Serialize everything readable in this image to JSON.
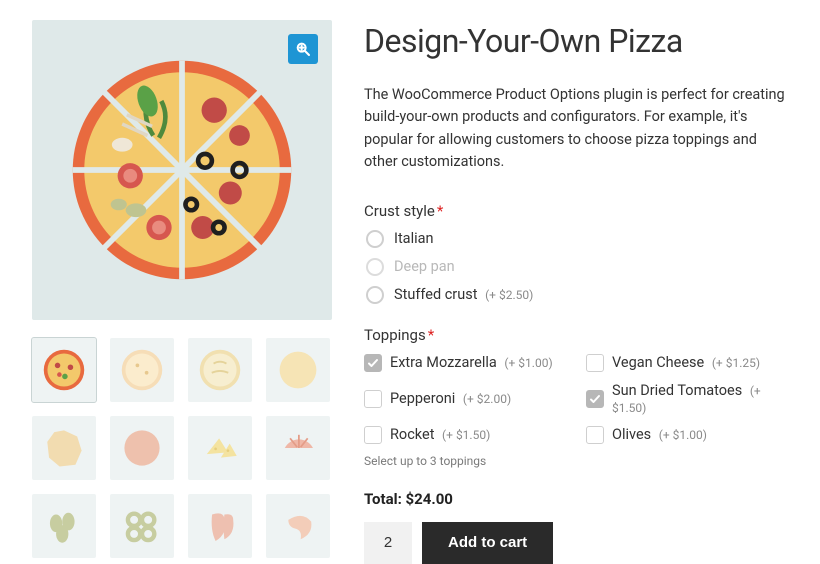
{
  "title": "Design-Your-Own Pizza",
  "description": "The WooCommerce Product Options plugin is perfect for creating build-your-own products and configurators. For example, it's popular for allowing customers to choose pizza toppings and other customizations.",
  "crust": {
    "label": "Crust style",
    "required_mark": "*",
    "options": [
      {
        "label": "Italian",
        "price": ""
      },
      {
        "label": "Deep pan",
        "price": ""
      },
      {
        "label": "Stuffed crust",
        "price": "(+ $2.50)"
      }
    ]
  },
  "toppings": {
    "label": "Toppings",
    "required_mark": "*",
    "options": [
      {
        "label": "Extra Mozzarella",
        "price": "(+ $1.00)",
        "checked": true
      },
      {
        "label": "Vegan Cheese",
        "price": "(+ $1.25)",
        "checked": false
      },
      {
        "label": "Pepperoni",
        "price": "(+ $2.00)",
        "checked": false
      },
      {
        "label": "Sun Dried Tomatoes",
        "price": "(+ $1.50)",
        "checked": true
      },
      {
        "label": "Rocket",
        "price": "(+ $1.50)",
        "checked": false
      },
      {
        "label": "Olives",
        "price": "(+ $1.00)",
        "checked": false
      }
    ],
    "helper": "Select up to 3 toppings"
  },
  "total_label": "Total: $24.00",
  "quantity": "2",
  "add_to_cart_label": "Add to cart",
  "thumbnails": [
    "pizza-full",
    "pizza-plain-light",
    "pizza-cheese",
    "dough-plain",
    "dough-beige",
    "dough-red",
    "cheese-chunks",
    "tomato-slice",
    "olives-green",
    "olive-rings",
    "chili",
    "shrimp"
  ],
  "colors": {
    "accent": "#1e95d4",
    "required": "#d22",
    "button": "#2a2a2a"
  }
}
